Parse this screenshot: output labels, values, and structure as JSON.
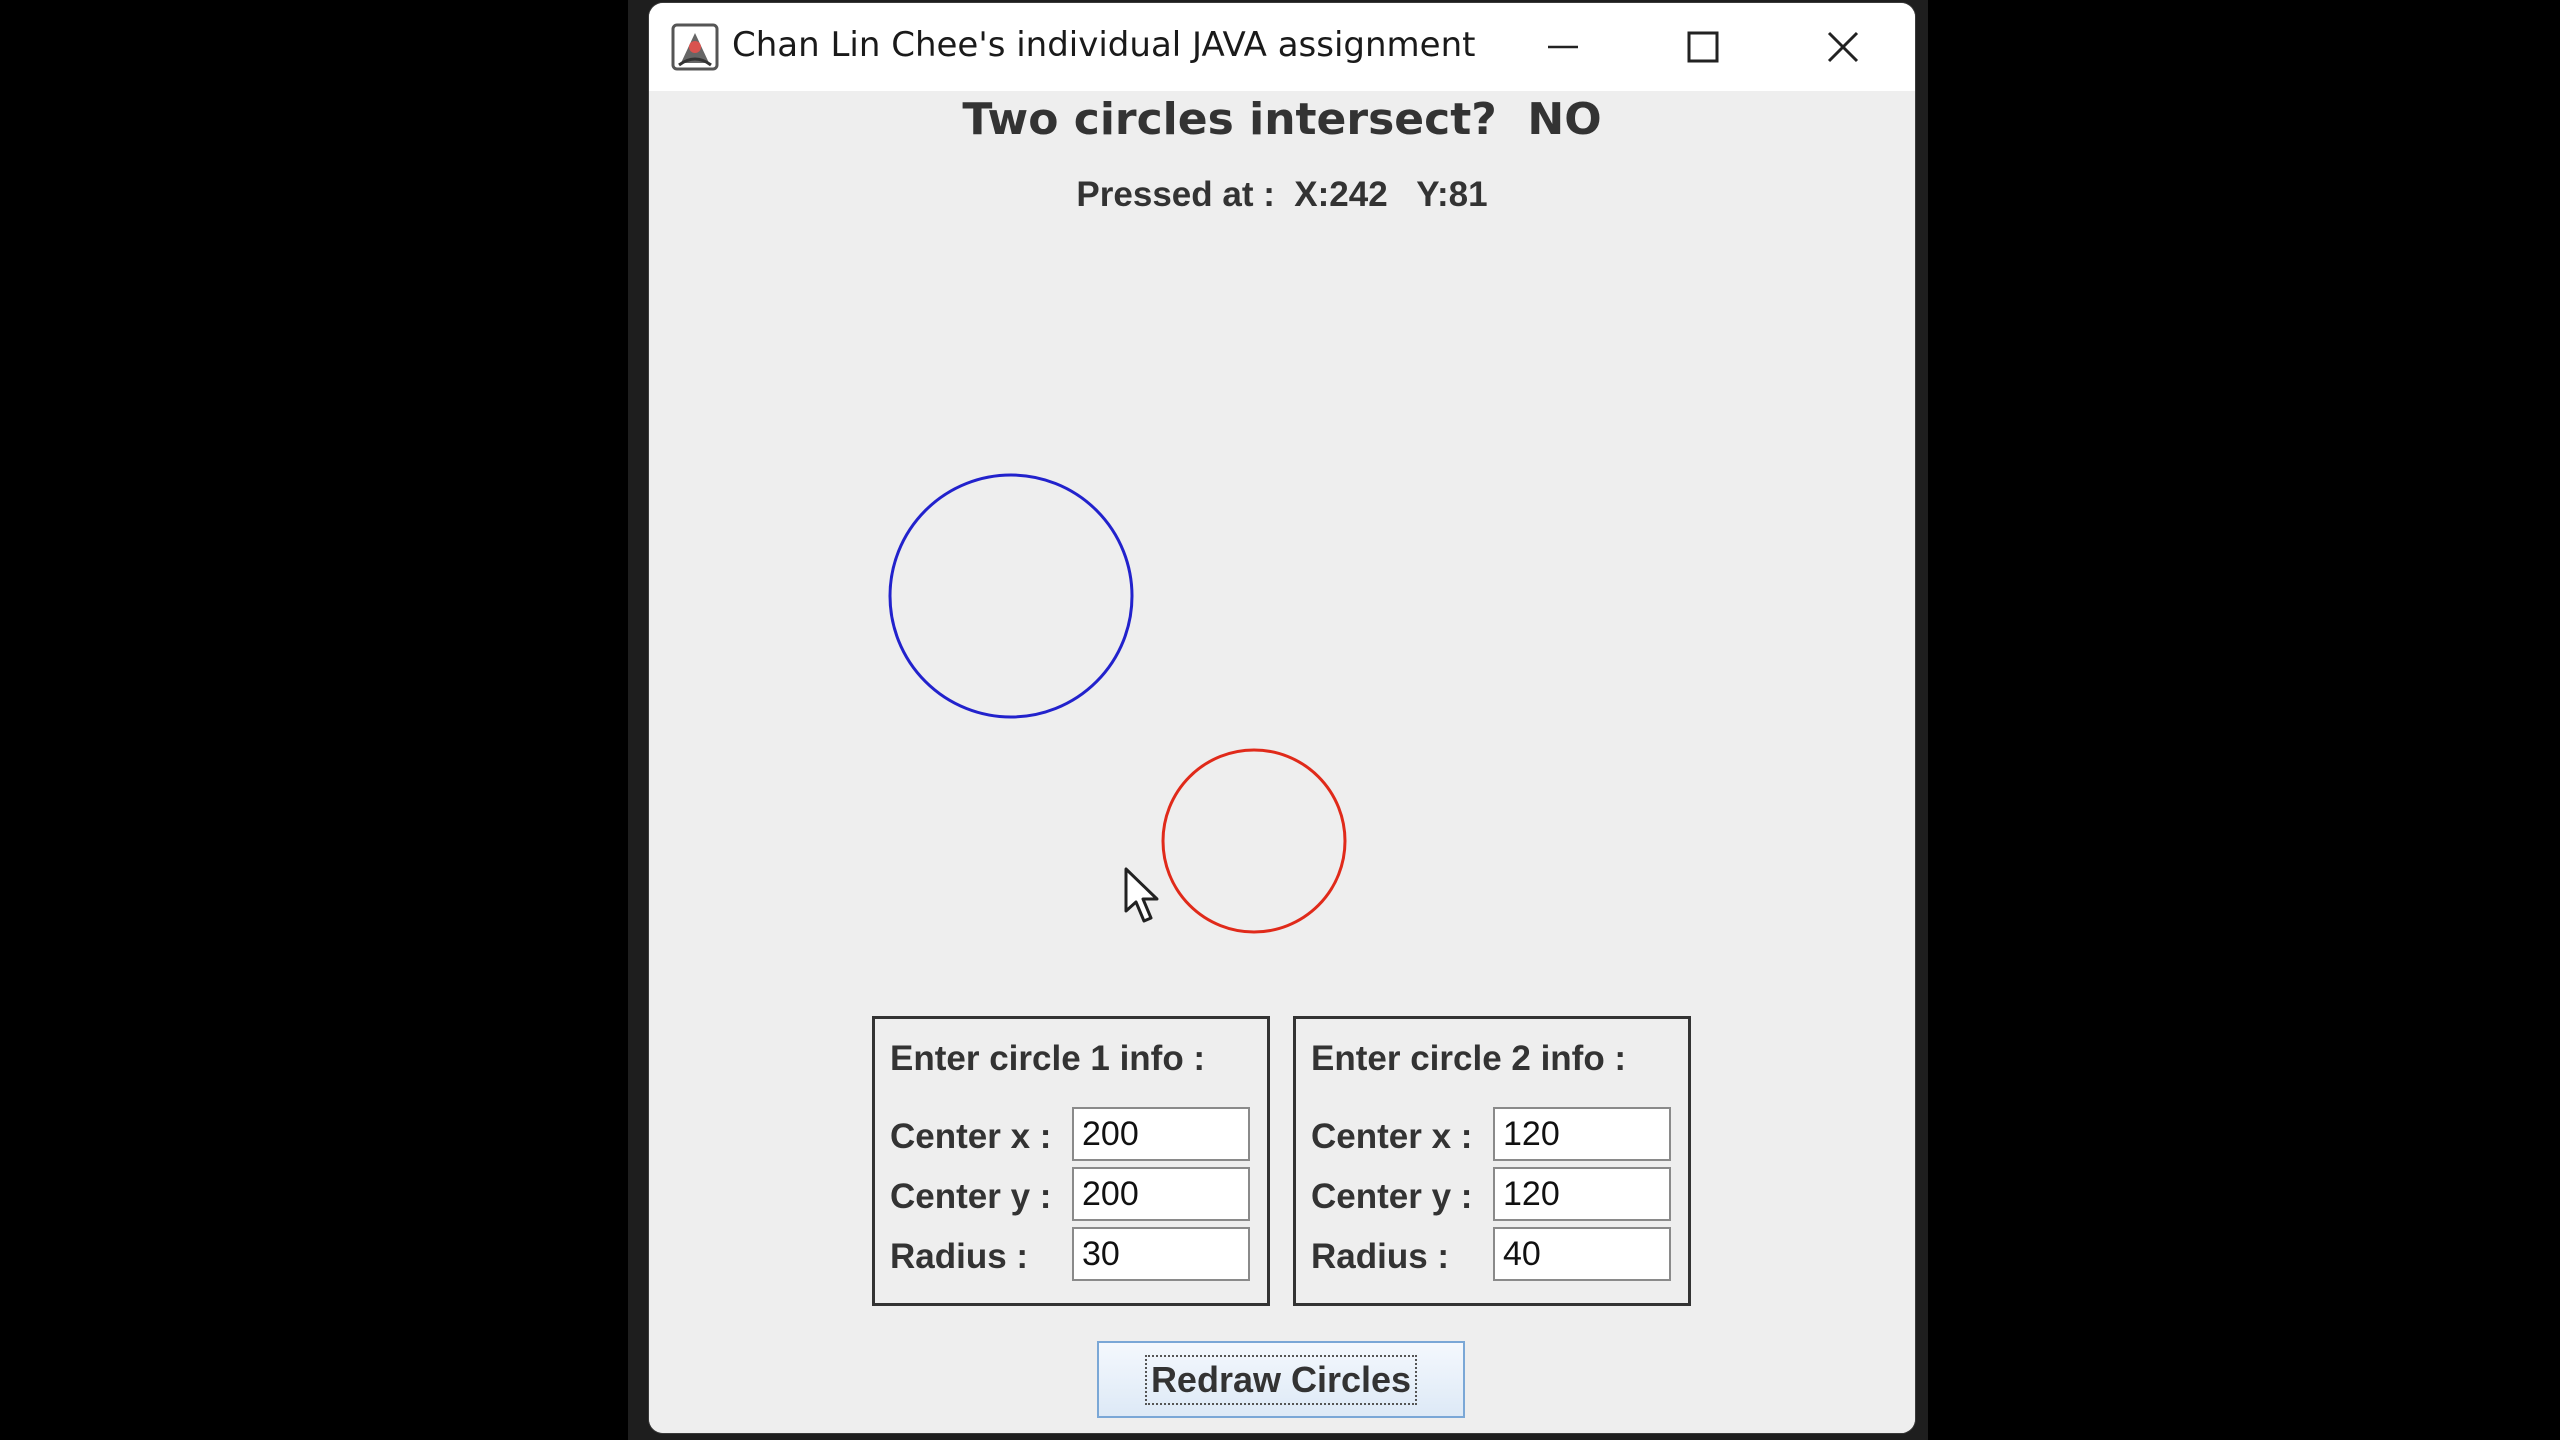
{
  "window": {
    "title": "Chan Lin Chee's individual JAVA assignment",
    "icon": "java-app-icon",
    "controls": [
      "minimize-icon",
      "maximize-icon",
      "close-icon"
    ]
  },
  "status": {
    "heading": "Two circles intersect?  NO",
    "pressed_label": "Pressed at :  X:242   Y:81"
  },
  "canvas": {
    "circles": [
      {
        "name": "circle-1",
        "color": "#2222cc"
      },
      {
        "name": "circle-2",
        "color": "#e02a1a"
      }
    ]
  },
  "panels": [
    {
      "title": "Enter circle 1 info :",
      "center_x_label": "Center x :",
      "center_x_value": "200",
      "center_y_label": "Center y :",
      "center_y_value": "200",
      "radius_label": "Radius :",
      "radius_value": "30"
    },
    {
      "title": "Enter circle 2 info :",
      "center_x_label": "Center x :",
      "center_x_value": "120",
      "center_y_label": "Center y :",
      "center_y_value": "120",
      "radius_label": "Radius :",
      "radius_value": "40"
    }
  ],
  "actions": {
    "redraw_label": "Redraw Circles"
  }
}
